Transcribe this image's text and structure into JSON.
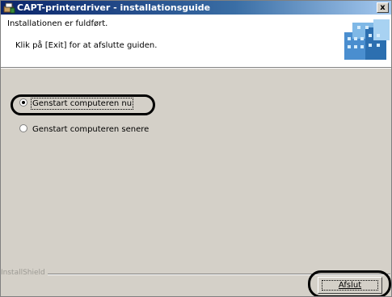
{
  "window": {
    "title": "CAPT-printerdriver - installationsguide",
    "close_glyph": "x"
  },
  "header": {
    "title": "Installationen er fuldført.",
    "subtitle": "Klik på [Exit] for at afslutte guiden."
  },
  "options": {
    "restart_now": {
      "label": "Genstart computeren nu",
      "selected": true
    },
    "restart_later": {
      "label": "Genstart computeren senere",
      "selected": false
    }
  },
  "footer": {
    "brand": "InstallShield",
    "finish_label": "Afslut"
  },
  "icons": {
    "title": "installer-icon",
    "header": "printer-logo-icon"
  },
  "colors": {
    "titlebar_start": "#0a246a",
    "titlebar_end": "#a6caf0",
    "dialog_bg": "#d4d0c8"
  }
}
